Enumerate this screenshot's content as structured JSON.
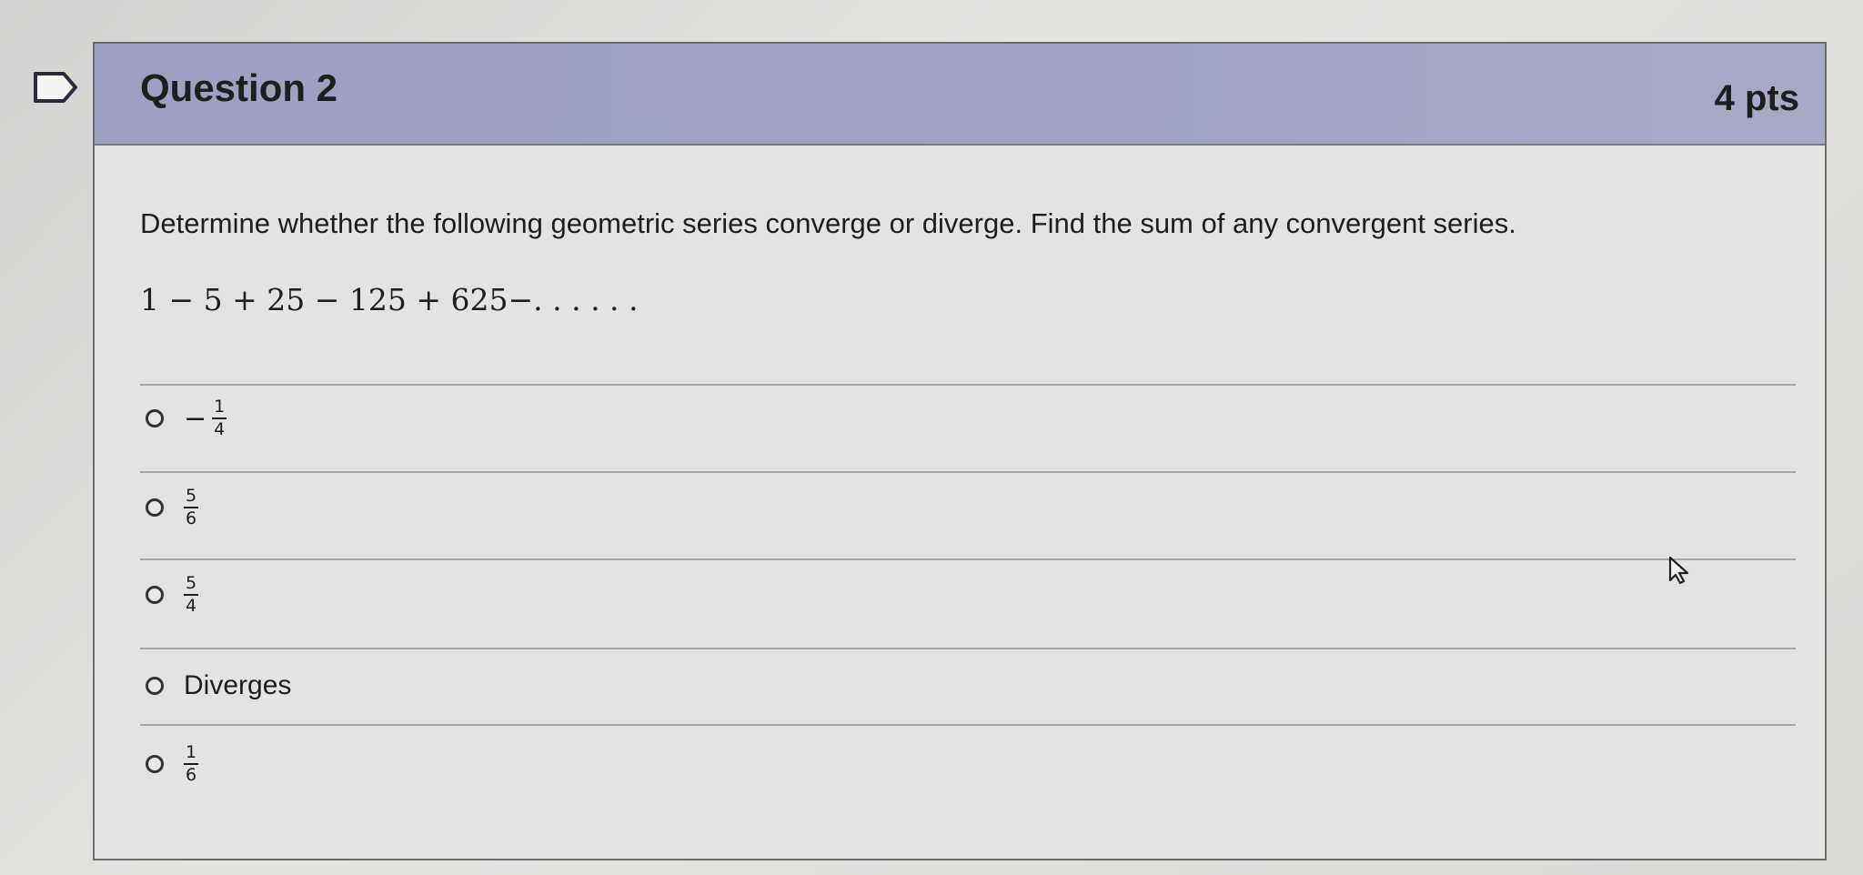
{
  "question": {
    "title": "Question 2",
    "points": "4 pts",
    "prompt": "Determine whether the following geometric series converge or diverge.  Find the sum of any convergent series.",
    "expression": "1 − 5 + 25 − 125 + 625−. . . . . ."
  },
  "answers": [
    {
      "sign": "−",
      "numerator": "1",
      "denominator": "4"
    },
    {
      "sign": "",
      "numerator": "5",
      "denominator": "6"
    },
    {
      "sign": "",
      "numerator": "5",
      "denominator": "4"
    },
    {
      "text": "Diverges"
    },
    {
      "sign": "",
      "numerator": "1",
      "denominator": "6"
    }
  ],
  "icons": {
    "flag": "bookmark-flag-icon",
    "cursor": "mouse-pointer-icon"
  },
  "colors": {
    "header_bg": "#a2a3c3",
    "card_bg": "#e3e3e1",
    "text": "#1e1e1e"
  }
}
